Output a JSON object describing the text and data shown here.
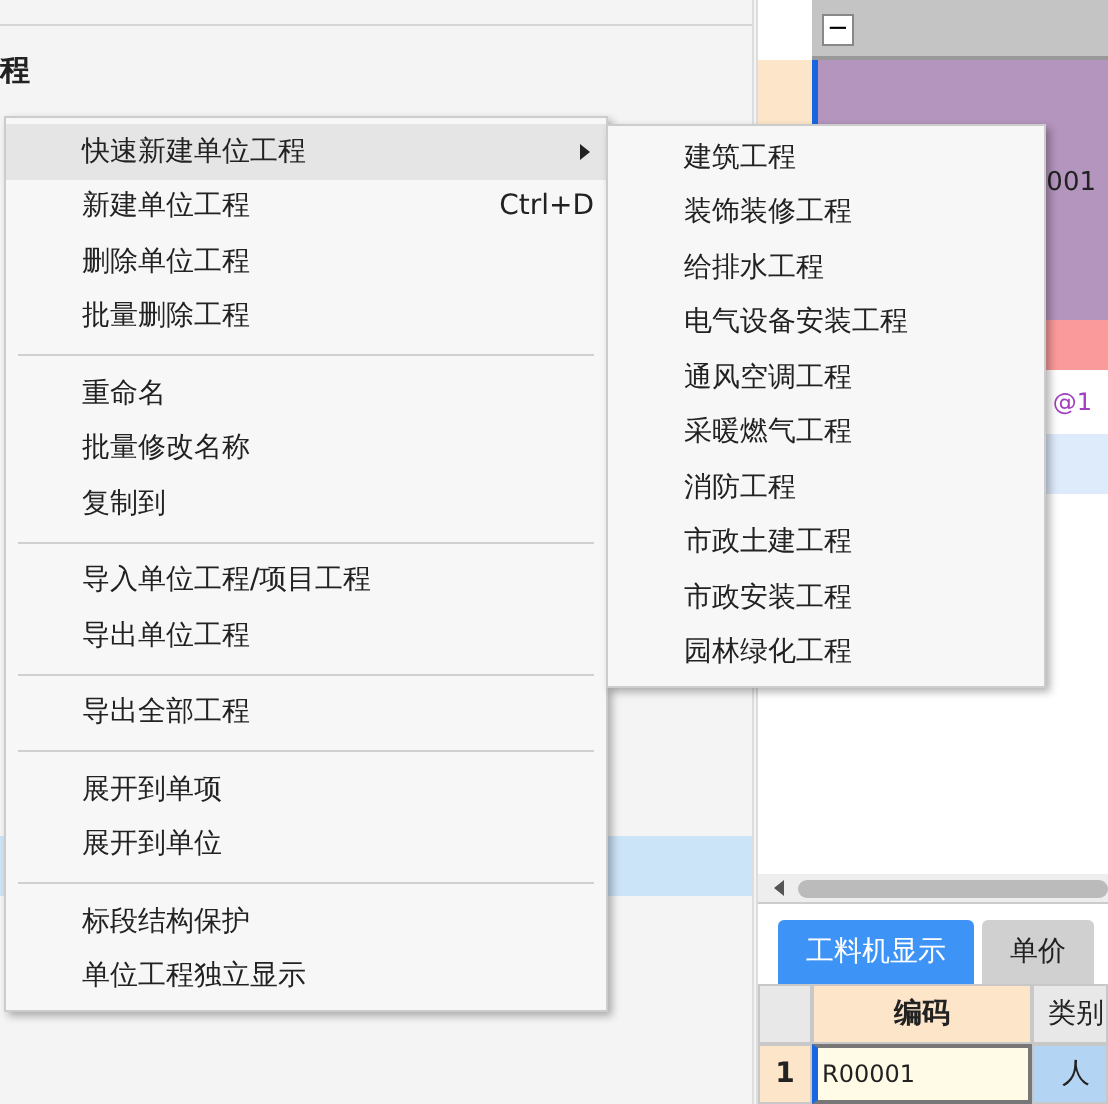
{
  "left_panel": {
    "title": "程"
  },
  "context_menu": {
    "items": [
      {
        "kind": "item",
        "label": "快速新建单位工程",
        "has_submenu": true,
        "selected": true
      },
      {
        "kind": "item",
        "label": "新建单位工程",
        "shortcut": "Ctrl+D",
        "selected": false
      },
      {
        "kind": "item",
        "label": "删除单位工程",
        "selected": false
      },
      {
        "kind": "item",
        "label": "批量删除工程",
        "selected": false
      },
      {
        "kind": "separator"
      },
      {
        "kind": "item",
        "label": "重命名",
        "selected": false
      },
      {
        "kind": "item",
        "label": "批量修改名称",
        "selected": false
      },
      {
        "kind": "item",
        "label": "复制到",
        "selected": false
      },
      {
        "kind": "separator"
      },
      {
        "kind": "item",
        "label": "导入单位工程/项目工程",
        "selected": false
      },
      {
        "kind": "item",
        "label": "导出单位工程",
        "selected": false
      },
      {
        "kind": "separator"
      },
      {
        "kind": "item",
        "label": "导出全部工程",
        "selected": false
      },
      {
        "kind": "separator"
      },
      {
        "kind": "item",
        "label": "展开到单项",
        "selected": false
      },
      {
        "kind": "item",
        "label": "展开到单位",
        "selected": false
      },
      {
        "kind": "separator"
      },
      {
        "kind": "item",
        "label": "标段结构保护",
        "selected": false
      },
      {
        "kind": "item",
        "label": "单位工程独立显示",
        "selected": false
      }
    ]
  },
  "submenu": {
    "items": [
      "建筑工程",
      "装饰装修工程",
      "给排水工程",
      "电气设备安装工程",
      "通风空调工程",
      "采暖燃气工程",
      "消防工程",
      "市政土建工程",
      "市政安装工程",
      "园林绿化工程"
    ]
  },
  "tree_grid": {
    "collapse_symbol": "−",
    "row_1_text": "001",
    "row_3_text": "@1"
  },
  "bottom_tabs": [
    {
      "label": "工料机显示",
      "selected": true
    },
    {
      "label": "单价",
      "selected": false
    }
  ],
  "table": {
    "columns": [
      "编码",
      "类别"
    ],
    "rows": [
      {
        "index": "1",
        "cells": [
          "R00001",
          "人"
        ]
      }
    ]
  }
}
